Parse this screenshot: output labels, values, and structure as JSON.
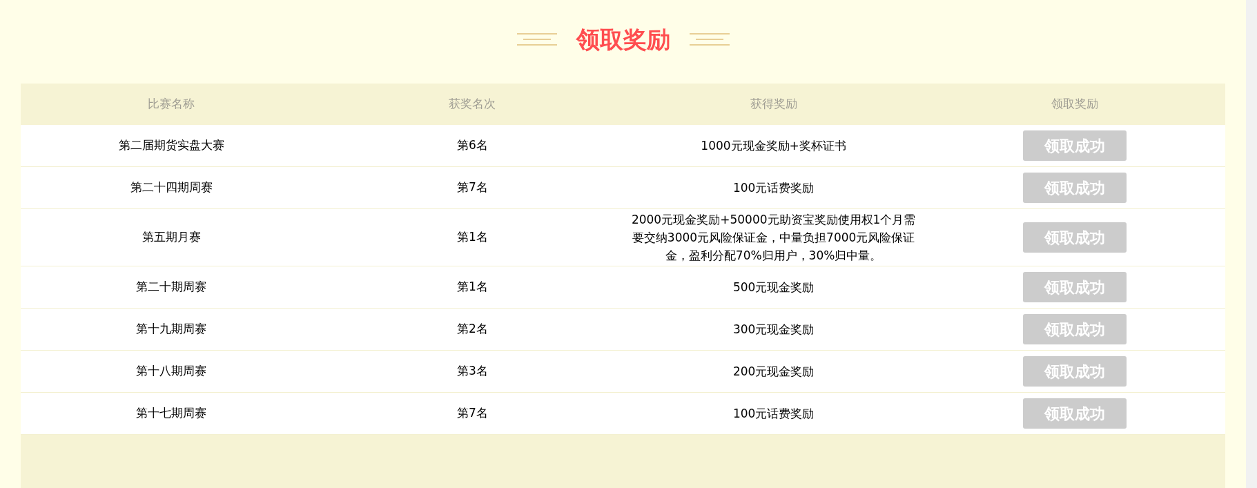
{
  "title": "领取奖励",
  "table": {
    "columns": [
      "比赛名称",
      "获奖名次",
      "获得奖励",
      "领取奖励"
    ],
    "rows": [
      {
        "contest": "第二届期货实盘大赛",
        "rank": "第6名",
        "reward": "1000元现金奖励+奖杯证书",
        "button": {
          "label": "领取成功",
          "disabled": true
        }
      },
      {
        "contest": "第二十四期周赛",
        "rank": "第7名",
        "reward": "100元话费奖励",
        "button": {
          "label": "领取成功",
          "disabled": true
        }
      },
      {
        "contest": "第五期月赛",
        "rank": "第1名",
        "reward": "2000元现金奖励+50000元助资宝奖励使用权1个月需要交纳3000元风险保证金，中量负担7000元风险保证金，盈利分配70%归用户，30%归中量。",
        "button": {
          "label": "领取成功",
          "disabled": true
        }
      },
      {
        "contest": "第二十期周赛",
        "rank": "第1名",
        "reward": "500元现金奖励",
        "button": {
          "label": "领取成功",
          "disabled": true
        }
      },
      {
        "contest": "第十九期周赛",
        "rank": "第2名",
        "reward": "300元现金奖励",
        "button": {
          "label": "领取成功",
          "disabled": true
        }
      },
      {
        "contest": "第十八期周赛",
        "rank": "第3名",
        "reward": "200元现金奖励",
        "button": {
          "label": "领取成功",
          "disabled": true
        }
      },
      {
        "contest": "第十七期周赛",
        "rank": "第7名",
        "reward": "100元话费奖励",
        "button": {
          "label": "领取成功",
          "disabled": true
        }
      }
    ]
  }
}
